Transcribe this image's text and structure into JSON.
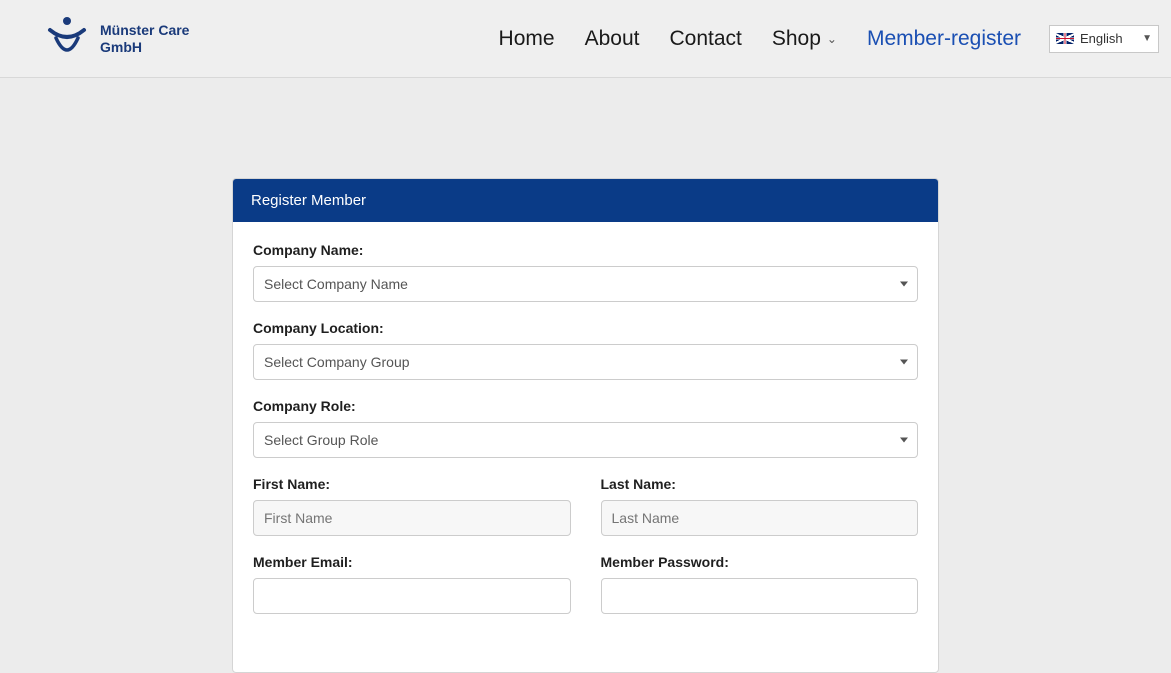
{
  "logo": {
    "line1": "Münster Care",
    "line2": "GmbH"
  },
  "nav": {
    "home": "Home",
    "about": "About",
    "contact": "Contact",
    "shop": "Shop",
    "member_register": "Member-register"
  },
  "lang": {
    "label": "English"
  },
  "form": {
    "title": "Register Member",
    "company_name_label": "Company Name:",
    "company_name_value": "Select Company Name",
    "company_location_label": "Company Location:",
    "company_location_value": "Select Company Group",
    "company_role_label": "Company Role:",
    "company_role_value": "Select Group Role",
    "first_name_label": "First Name:",
    "first_name_placeholder": "First Name",
    "last_name_label": "Last Name:",
    "last_name_placeholder": "Last Name",
    "email_label": "Member Email:",
    "password_label": "Member Password:"
  }
}
